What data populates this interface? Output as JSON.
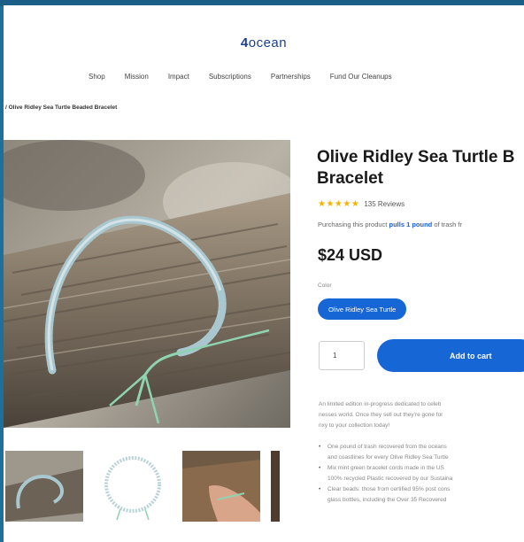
{
  "header": {
    "logo_prefix": "4",
    "logo_text": "ocean"
  },
  "nav": {
    "items": [
      "Shop",
      "Mission",
      "Impact",
      "Subscriptions",
      "Partnerships",
      "Fund Our Cleanups"
    ]
  },
  "breadcrumb": "/ Olive Ridley Sea Turtle Beaded Bracelet",
  "product": {
    "title_line1": "Olive Ridley Sea Turtle B",
    "title_line2": "Bracelet",
    "stars": "★★★★★",
    "reviews": "135 Reviews",
    "purchasing_prefix": "Purchasing this product",
    "purchasing_highlight": "pulls 1 pound",
    "purchasing_suffix": "of trash fr",
    "price": "$24 USD",
    "color_label": "Color",
    "color_selected": "Olive Ridley Sea Turtle",
    "quantity": "1",
    "add_to_cart": "Add to cart",
    "desc_line1": "An limited edition in-progress dedicated to celeb",
    "desc_line2": "nesses world. Once they sell out they're gone for",
    "desc_line3": "nxy to your collection today!",
    "bullets": [
      [
        "One pound of trash recovered from the oceans",
        "and coastlines for every Olive Ridley Sea Turtle"
      ],
      [
        "Mix mint green bracelet cords made in the US",
        "100% recycled Plastic recovered by our Sustaina"
      ],
      [
        "Clear beads: those from certified 95% post cons",
        "glass bottles, including the Over 35 Recovered"
      ]
    ]
  },
  "colors": {
    "accent": "#1766d6",
    "stars": "#f5b301",
    "logo": "#1a3f8f"
  }
}
